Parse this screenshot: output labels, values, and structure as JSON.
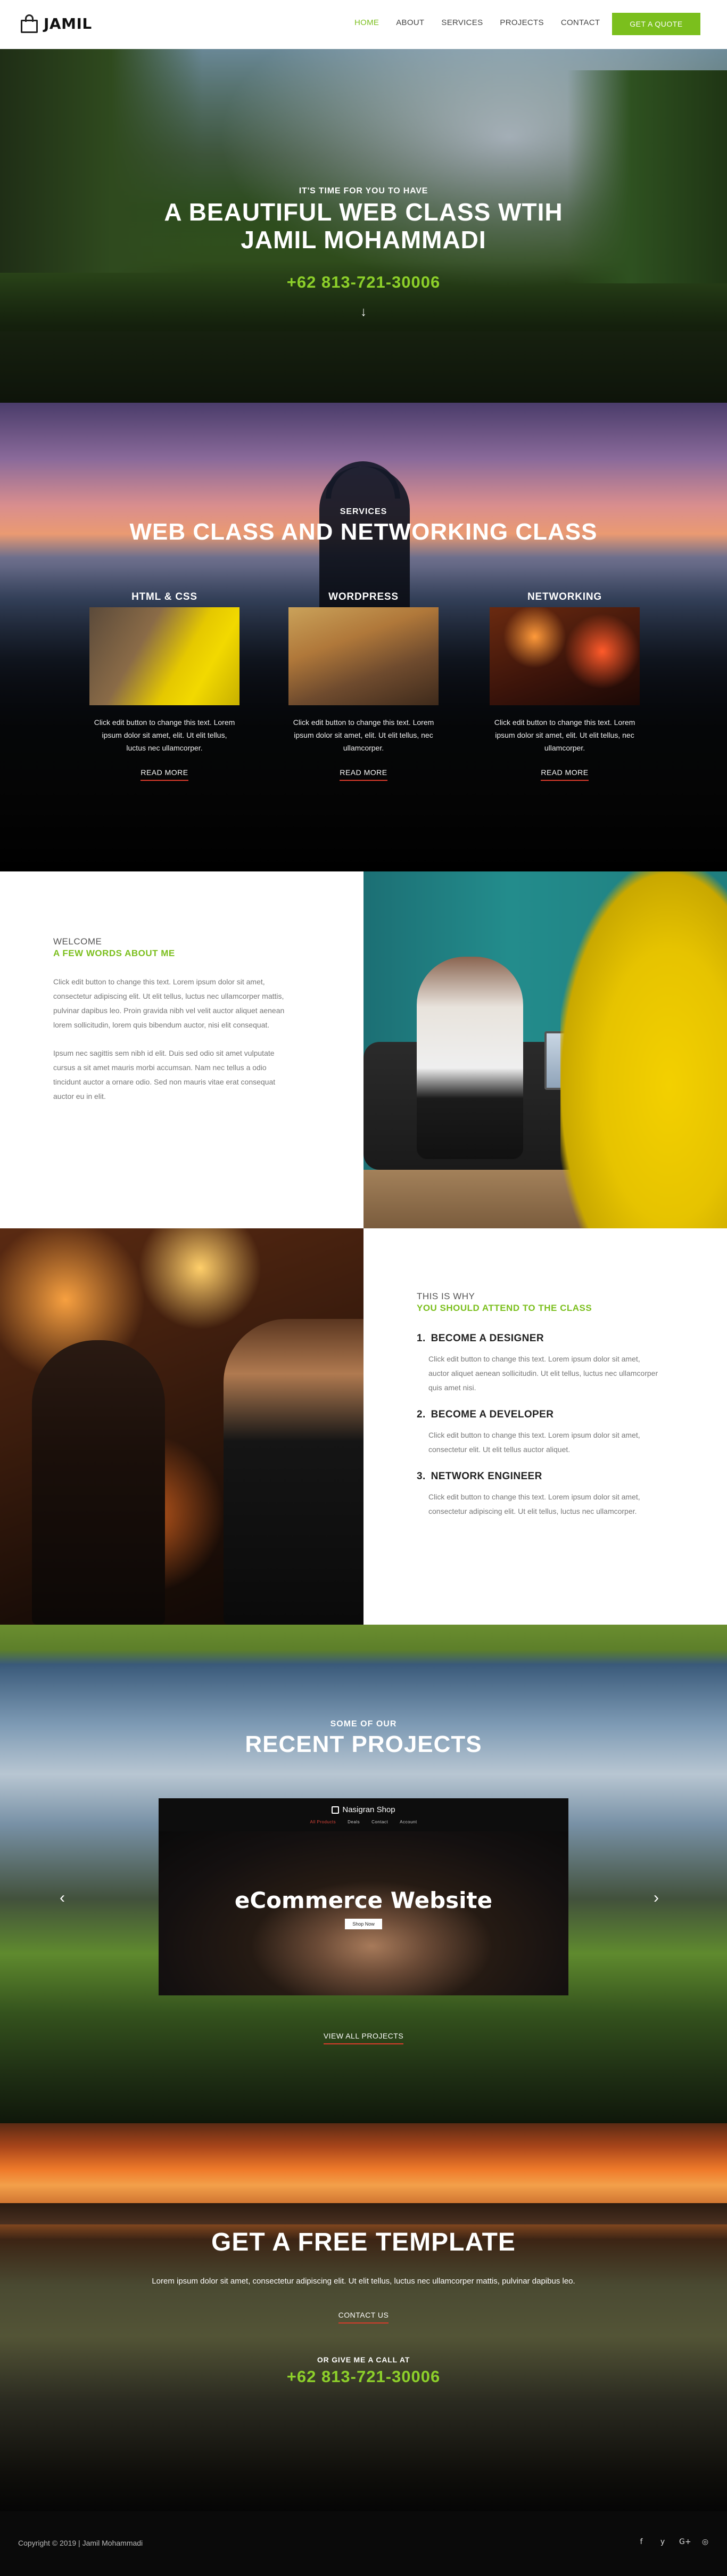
{
  "header": {
    "logo_text": "JAMIL",
    "nav": [
      "HOME",
      "ABOUT",
      "SERVICES",
      "PROJECTS",
      "CONTACT"
    ],
    "active_nav": "HOME",
    "quote_button": "GET A QUOTE",
    "accent_color": "#7bbf1d"
  },
  "hero": {
    "pre_title": "IT'S TIME FOR YOU TO HAVE",
    "title_line1": "A BEAUTIFUL WEB CLASS WTIH",
    "title_line2": "JAMIL MOHAMMADI",
    "phone": "+62 813-721-30006",
    "scroll_icon": "arrow-down-icon"
  },
  "services": {
    "pre_title": "SERVICES",
    "title": "WEB CLASS AND NETWORKING CLASS",
    "items": [
      {
        "label": "HTML & CSS",
        "text": "Click edit button to change this text. Lorem ipsum dolor sit amet, elit. Ut elit tellus, luctus nec ullamcorper.",
        "link": "READ MORE"
      },
      {
        "label": "WORDPRESS",
        "text": "Click edit button to change this text. Lorem ipsum dolor sit amet, elit. Ut elit tellus, nec ullamcorper.",
        "link": "READ MORE"
      },
      {
        "label": "NETWORKING",
        "text": "Click edit button to change this text. Lorem ipsum dolor sit amet, elit. Ut elit tellus, nec ullamcorper.",
        "link": "READ MORE"
      }
    ]
  },
  "about": {
    "eyebrow": "WELCOME",
    "heading": "A FEW WORDS ABOUT ME",
    "paragraph1": "Click edit button to change this text. Lorem ipsum dolor sit amet, consectetur adipiscing elit. Ut elit tellus, luctus nec ullamcorper mattis, pulvinar dapibus leo. Proin gravida nibh vel velit auctor aliquet aenean lorem sollicitudin, lorem quis bibendum auctor, nisi elit consequat.",
    "paragraph2": "Ipsum nec sagittis sem nibh id elit. Duis sed odio sit amet vulputate cursus a sit amet mauris morbi accumsan. Nam nec tellus a odio tincidunt auctor a ornare odio. Sed non mauris vitae erat consequat auctor eu in elit."
  },
  "why": {
    "eyebrow": "THIS IS WHY",
    "heading": "YOU SHOULD ATTEND TO THE CLASS",
    "items": [
      {
        "num": "1.",
        "title": "BECOME A DESIGNER",
        "text": "Click edit button to change this text. Lorem ipsum dolor sit amet, auctor aliquet aenean sollicitudin. Ut elit tellus, luctus nec ullamcorper quis amet nisi."
      },
      {
        "num": "2.",
        "title": "BECOME A DEVELOPER",
        "text": "Click edit button to change this text. Lorem ipsum dolor sit amet, consectetur elit. Ut elit tellus auctor aliquet."
      },
      {
        "num": "3.",
        "title": "NETWORK ENGINEER",
        "text": "Click edit button to change this text. Lorem ipsum dolor sit amet, consectetur adipiscing elit. Ut elit tellus, luctus nec ullamcorper."
      }
    ]
  },
  "projects": {
    "pre_title": "SOME OF OUR",
    "title": "RECENT PROJECTS",
    "slide": {
      "brand": "Nasigran Shop",
      "nav": [
        "All Products",
        "Deals",
        "Contact",
        "Account"
      ],
      "title": "eCommerce Website",
      "button": "Shop Now"
    },
    "prev_icon": "chevron-left-icon",
    "next_icon": "chevron-right-icon",
    "view_all": "VIEW ALL PROJECTS"
  },
  "cta": {
    "title": "GET A FREE TEMPLATE",
    "text": "Lorem ipsum dolor sit amet, consectetur adipiscing elit. Ut elit tellus, luctus nec ullamcorper mattis, pulvinar dapibus leo.",
    "link": "CONTACT US",
    "pre_phone": "OR GIVE ME A CALL AT",
    "phone": "+62 813-721-30006"
  },
  "footer": {
    "copyright": "Copyright © 2019 | Jamil Mohammadi",
    "social": [
      {
        "icon": "facebook-icon",
        "glyph": "f"
      },
      {
        "icon": "twitter-icon",
        "glyph": "y"
      },
      {
        "icon": "google-plus-icon",
        "glyph": "G+"
      },
      {
        "icon": "instagram-icon",
        "glyph": "◎"
      }
    ]
  }
}
